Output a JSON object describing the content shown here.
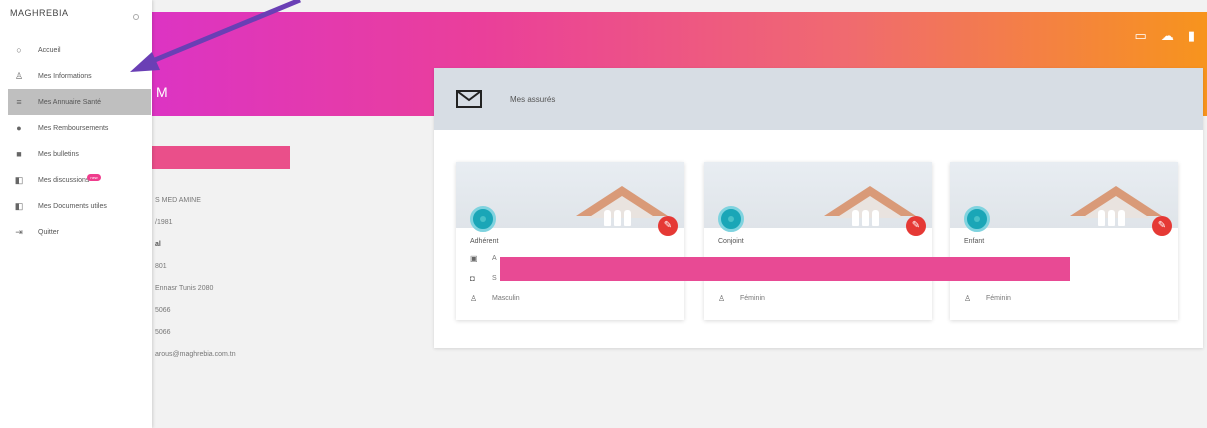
{
  "brand": "MAGHREBIA",
  "banner_letter": "M",
  "top_icons": [
    "window-icon",
    "cloud-user-icon",
    "exit-icon"
  ],
  "menu": [
    {
      "label": "Accueil",
      "icon": "○",
      "name": "home-icon"
    },
    {
      "label": "Mes Informations",
      "icon": "♙",
      "name": "user-icon"
    },
    {
      "label": "Mes Annuaire Santé",
      "icon": "≡",
      "name": "list-icon",
      "active": true
    },
    {
      "label": "Mes Remboursements",
      "icon": "●",
      "name": "eye-icon"
    },
    {
      "label": "Mes bulletins",
      "icon": "■",
      "name": "folder-icon"
    },
    {
      "label": "Mes discussions",
      "icon": "◧",
      "name": "chat-icon",
      "badge": "new"
    },
    {
      "label": "Mes Documents utiles",
      "icon": "◧",
      "name": "document-icon"
    },
    {
      "label": "Quitter",
      "icon": "⇥",
      "name": "logout-icon"
    }
  ],
  "profile": {
    "l1": "S MED AMINE",
    "l2": "/1981",
    "l3": "al",
    "l4": "801",
    "l5": "Ennasr Tunis 2080",
    "l6": "5066",
    "l7": "5066",
    "l8": "arous@maghrebia.com.tn"
  },
  "panel": {
    "title": "Mes assurés"
  },
  "cards": [
    {
      "title": "Adhérent",
      "r1": "A",
      "r2": "S",
      "r3": "Masculin"
    },
    {
      "title": "Conjoint",
      "r1": "",
      "r2": "",
      "r3": "Féminin"
    },
    {
      "title": "Enfant",
      "r1": "",
      "r2": "",
      "r3": "Féminin"
    }
  ],
  "colors": {
    "accent_pink": "#ea3f9a",
    "accent_orange": "#f7941d",
    "teal": "#1aa6b7",
    "edit_red": "#e53935",
    "annotation_arrow": "#6a3fb5"
  }
}
